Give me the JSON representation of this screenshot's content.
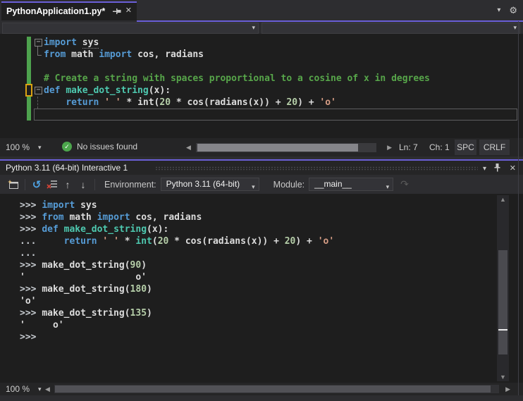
{
  "colors": {
    "accent": "#6a5fd8",
    "kw": "#569CD6",
    "cm": "#57A64A",
    "str": "#D69D85",
    "num": "#B5CEA8",
    "fn": "#4EC9B0",
    "pl": "#DCDCDC",
    "pr": "#C6CBD0",
    "check_green": "#4CA64C",
    "reset_blue": "#4FA3E3",
    "changebar_green": "#4EA24E",
    "changebar_orange": "#D9A112"
  },
  "icons": {
    "gear": "⚙",
    "caret": "▾",
    "close": "✕",
    "check": "✓",
    "reset": "↺",
    "up": "↑",
    "down": "↓",
    "redo": "↷",
    "scroll_left": "◀",
    "scroll_right": "▶",
    "scroll_up": "▲",
    "scroll_down": "▼",
    "box_minus": "−"
  },
  "tab": {
    "title": "PythonApplication1.py*"
  },
  "editor_status": {
    "zoom": "100 %",
    "issues": "No issues found",
    "line": "Ln: 7",
    "column": "Ch: 1",
    "indent": "SPC",
    "eol": "CRLF"
  },
  "interactive": {
    "title": "Python 3.11 (64-bit) Interactive 1",
    "environment_label": "Environment:",
    "environment_value": "Python 3.11 (64-bit)",
    "module_label": "Module:",
    "module_value": "__main__",
    "zoom": "100 %"
  },
  "editor": {
    "lines": [
      {
        "m": "box",
        "s": [
          [
            "kw",
            "import"
          ],
          [
            "pl",
            " "
          ],
          [
            "pl-sq",
            "sys"
          ]
        ]
      },
      {
        "m": "end",
        "s": [
          [
            "kw",
            "from"
          ],
          [
            "pl",
            " math "
          ],
          [
            "kw",
            "import"
          ],
          [
            "pl",
            " cos, radians"
          ]
        ]
      },
      {
        "m": "",
        "s": []
      },
      {
        "m": "",
        "s": [
          [
            "cm",
            "# Create a string with spaces proportional to a cosine of x in degrees"
          ]
        ]
      },
      {
        "m": "box",
        "s": [
          [
            "kw",
            "def"
          ],
          [
            "pl",
            " "
          ],
          [
            "fn",
            "make_dot_string"
          ],
          [
            "pl",
            "(x):"
          ]
        ]
      },
      {
        "m": "dash",
        "s": [
          [
            "pl",
            "    "
          ],
          [
            "kw",
            "return"
          ],
          [
            "pl",
            " "
          ],
          [
            "str",
            "' '"
          ],
          [
            "pl",
            " * int("
          ],
          [
            "num",
            "20"
          ],
          [
            "pl",
            " * cos(radians(x)) + "
          ],
          [
            "num",
            "20"
          ],
          [
            "pl",
            ") + "
          ],
          [
            "str",
            "'o'"
          ]
        ]
      },
      {
        "m": "",
        "s": []
      }
    ]
  },
  "repl": {
    "lines": [
      {
        "s": [
          [
            "pr",
            ">>> "
          ],
          [
            "kw",
            "import"
          ],
          [
            "pl",
            " sys"
          ]
        ]
      },
      {
        "s": [
          [
            "pr",
            ">>> "
          ],
          [
            "kw",
            "from"
          ],
          [
            "pl",
            " math "
          ],
          [
            "kw",
            "import"
          ],
          [
            "pl",
            " cos, radians"
          ]
        ]
      },
      {
        "s": [
          [
            "pr",
            ">>> "
          ],
          [
            "kw",
            "def"
          ],
          [
            "pl",
            " "
          ],
          [
            "fn",
            "make_dot_string"
          ],
          [
            "pl",
            "(x):"
          ]
        ]
      },
      {
        "s": [
          [
            "pr",
            "... "
          ],
          [
            "pl",
            "    "
          ],
          [
            "kw",
            "return"
          ],
          [
            "pl",
            " "
          ],
          [
            "str",
            "' '"
          ],
          [
            "pl",
            " * "
          ],
          [
            "fn",
            "int"
          ],
          [
            "pl",
            "("
          ],
          [
            "num",
            "20"
          ],
          [
            "pl",
            " * cos(radians(x)) + "
          ],
          [
            "num",
            "20"
          ],
          [
            "pl",
            ") + "
          ],
          [
            "str",
            "'o'"
          ]
        ]
      },
      {
        "s": [
          [
            "pr",
            "..."
          ]
        ]
      },
      {
        "s": [
          [
            "pr",
            ">>> "
          ],
          [
            "pl",
            "make_dot_string("
          ],
          [
            "num",
            "90"
          ],
          [
            "pl",
            ")"
          ]
        ]
      },
      {
        "s": [
          [
            "pl",
            "'                    o'"
          ]
        ]
      },
      {
        "s": [
          [
            "pr",
            ">>> "
          ],
          [
            "pl",
            "make_dot_string("
          ],
          [
            "num",
            "180"
          ],
          [
            "pl",
            ")"
          ]
        ]
      },
      {
        "s": [
          [
            "pl",
            "'o'"
          ]
        ]
      },
      {
        "s": [
          [
            "pr",
            ">>> "
          ],
          [
            "pl",
            "make_dot_string("
          ],
          [
            "num",
            "135"
          ],
          [
            "pl",
            ")"
          ]
        ]
      },
      {
        "s": [
          [
            "pl",
            "'     o'"
          ]
        ]
      },
      {
        "s": [
          [
            "pr",
            ">>>"
          ]
        ]
      }
    ]
  }
}
